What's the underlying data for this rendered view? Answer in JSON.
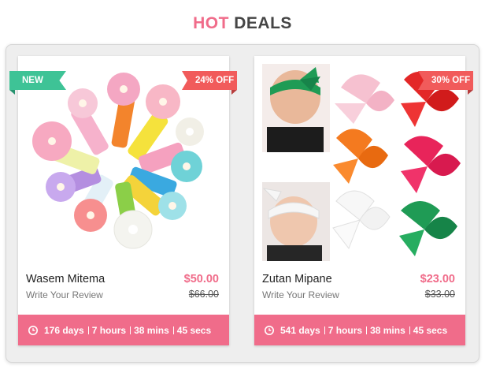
{
  "header": {
    "hot": "HOT",
    "deals": "DEALS"
  },
  "products": [
    {
      "badge_left": "NEW",
      "badge_right": "24% OFF",
      "name": "Wasem Mitema",
      "review": "Write Your Review",
      "price": "$50.00",
      "old_price": "$66.00",
      "timer": {
        "days": "176 days",
        "hours": "7 hours",
        "mins": "38 mins",
        "secs": "45 secs"
      }
    },
    {
      "badge_right": "30% OFF",
      "name": "Zutan Mipane",
      "review": "Write Your Review",
      "price": "$23.00",
      "old_price": "$33.00",
      "timer": {
        "days": "541 days",
        "hours": "7 hours",
        "mins": "38 mins",
        "secs": "45 secs"
      }
    }
  ],
  "colors": {
    "accent": "#f06c8a",
    "new_badge": "#3ec396",
    "off_badge": "#f15b5b",
    "title_dark": "#454545"
  },
  "icons": {
    "timer": "clock-icon"
  }
}
